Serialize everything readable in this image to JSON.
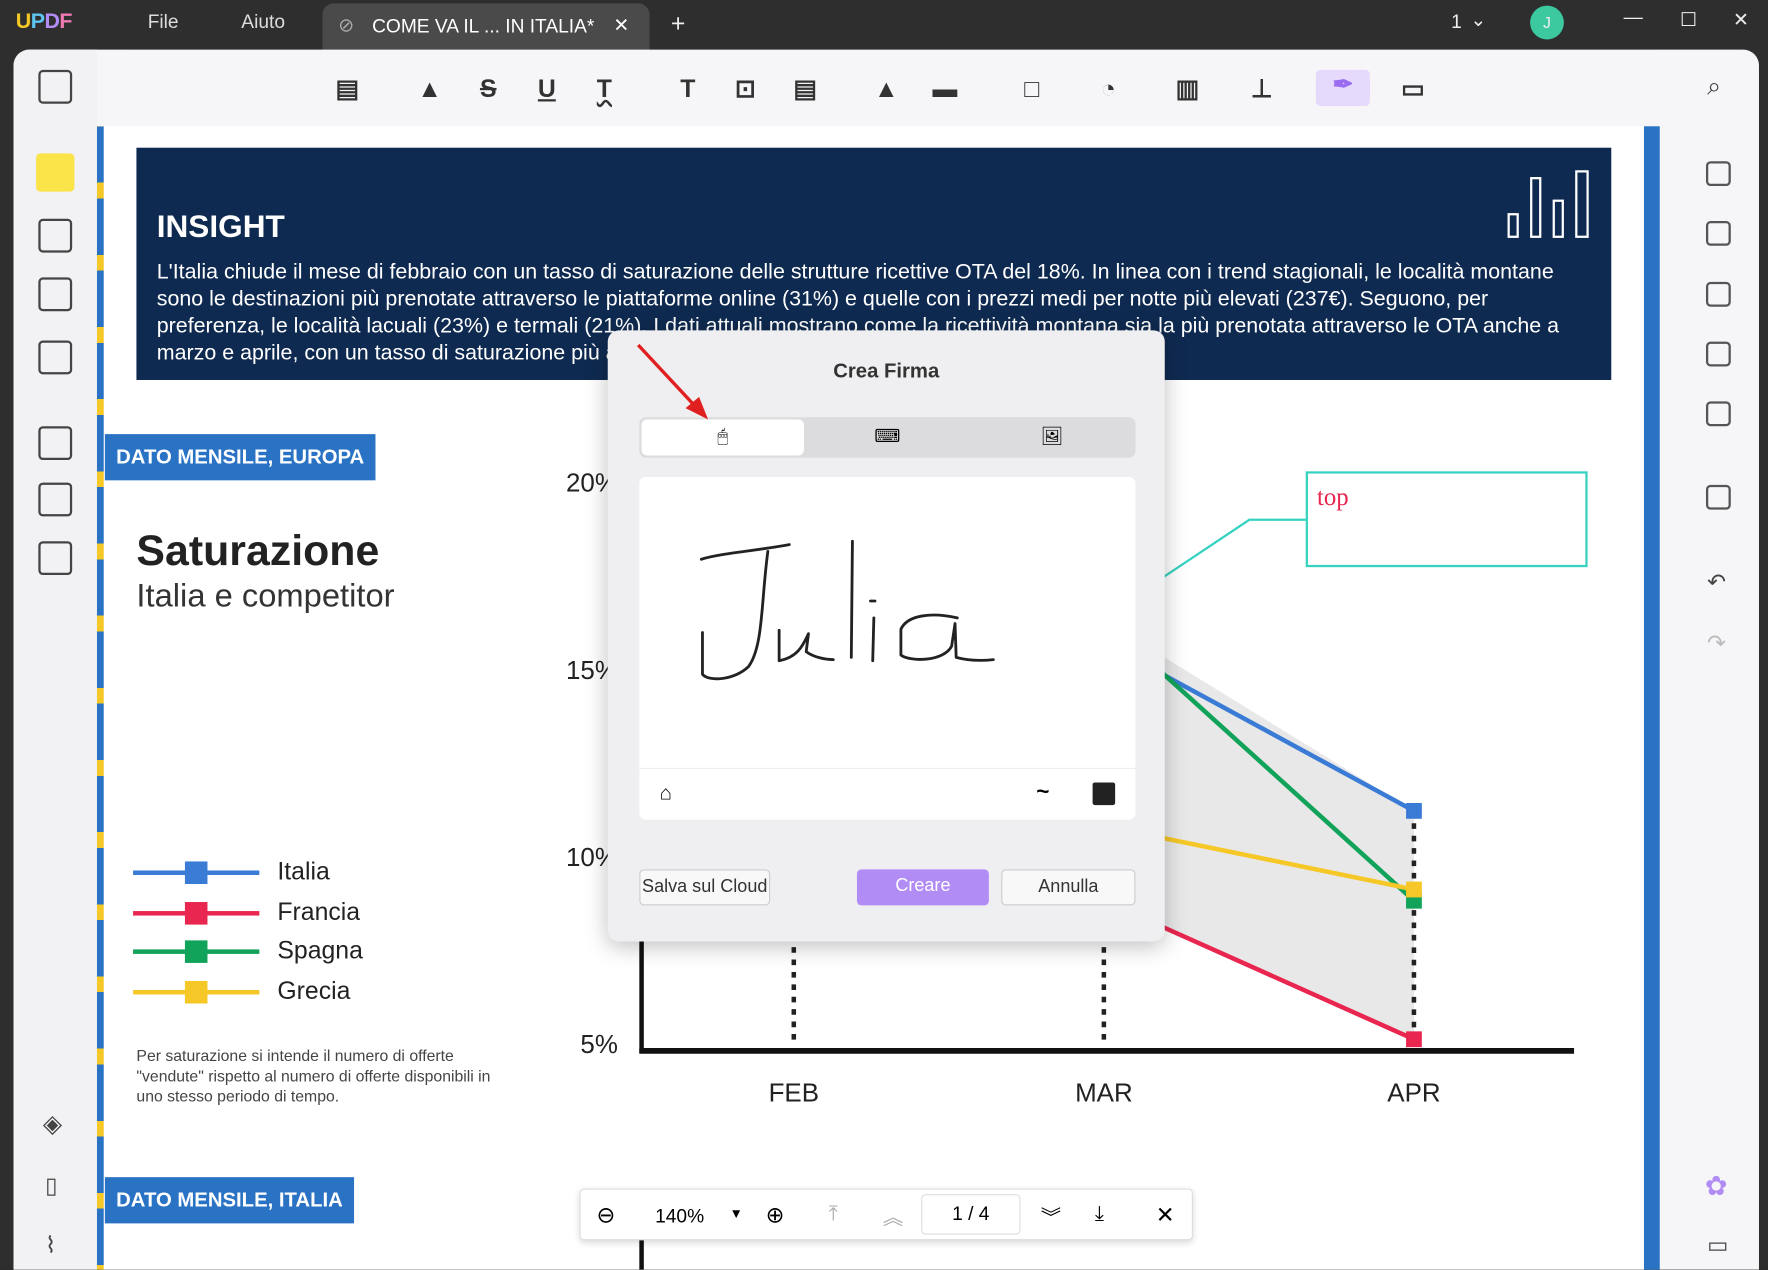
{
  "titlebar": {
    "logo": "UPDF",
    "menu": [
      "File",
      "Aiuto"
    ],
    "tab_title": "COME VA IL ... IN ITALIA*",
    "page_indicator": "1",
    "avatar": "J"
  },
  "toolbar": {
    "tools": [
      "comment",
      "highlight",
      "strikethrough",
      "underline",
      "squiggly",
      "text",
      "textbox",
      "text-callout",
      "pencil",
      "eraser",
      "shape",
      "sticker",
      "chart",
      "stamp",
      "signature",
      "measure"
    ],
    "active": "signature",
    "accent": "#b28cf5"
  },
  "document": {
    "insight": {
      "title": "INSIGHT",
      "body": "L'Italia chiude il mese di febbraio con un tasso di saturazione delle strutture ricettive OTA del 18%. In linea con i trend stagionali, le località montane  sono le destinazioni più prenotate attraverso le piattaforme online (31%) e quelle con i prezzi medi per notte più elevati (237€). Seguono, per preferenza, le località lacuali (23%) e termali (21%). I dati attuali mostrano come la ricettività montana sia la più prenotata attraverso le OTA anche a marzo e aprile, con un tasso di saturazione più alto rispetto a quelli degli altri prodotti geografici."
    },
    "badge_europe": "DATO MENSILE, EUROPA",
    "heading": "Saturazione",
    "subheading": "Italia e competitor",
    "legend": [
      {
        "name": "Italia",
        "color": "#3a7bd5"
      },
      {
        "name": "Francia",
        "color": "#e8264f"
      },
      {
        "name": "Spagna",
        "color": "#12a35a"
      },
      {
        "name": "Grecia",
        "color": "#f5c827"
      }
    ],
    "footnote": "Per saturazione si intende il numero di offerte \"vendute\" rispetto al numero di offerte disponibili in uno stesso periodo di tempo.",
    "badge_italy": "DATO MENSILE, ITALIA",
    "annotation": "top"
  },
  "chart_data": {
    "type": "line",
    "categories": [
      "FEB",
      "MAR",
      "APR"
    ],
    "yticks": [
      "5%",
      "10%",
      "15%",
      "20%"
    ],
    "ylim": [
      5,
      20
    ],
    "series": [
      {
        "name": "Italia",
        "values": [
          null,
          15.7,
          11.2
        ]
      },
      {
        "name": "Francia",
        "values": [
          null,
          8.8,
          5.1
        ]
      },
      {
        "name": "Spagna",
        "values": [
          null,
          16.3,
          8.8
        ]
      },
      {
        "name": "Grecia",
        "values": [
          null,
          10.8,
          9.1
        ]
      }
    ]
  },
  "dialog": {
    "title": "Crea Firma",
    "tabs": [
      "mouse",
      "keyboard",
      "image"
    ],
    "active_tab": "mouse",
    "signature": "Julia",
    "save_cloud": "Salva sul Cloud",
    "create": "Creare",
    "cancel": "Annulla",
    "ink_color": "#222222"
  },
  "pagebar": {
    "zoom": "140%",
    "page": "1 / 4"
  }
}
